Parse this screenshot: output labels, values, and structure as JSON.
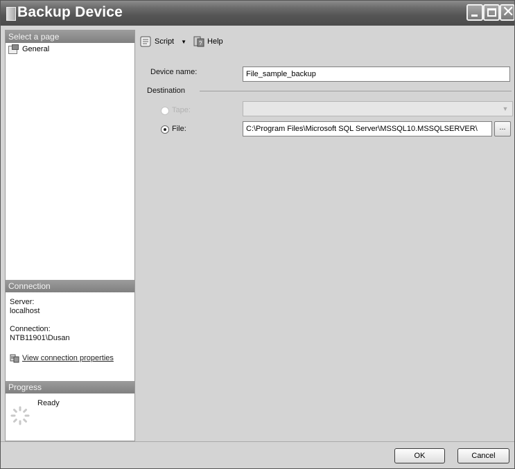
{
  "window": {
    "title": "Backup Device"
  },
  "left_pane": {
    "select_page_header": "Select a page",
    "pages": [
      {
        "label": "General",
        "icon": "page-icon"
      }
    ],
    "connection_header": "Connection",
    "server_label": "Server:",
    "server_value": "localhost",
    "connection_label": "Connection:",
    "connection_value": "NTB11901\\Dusan",
    "view_connection_link": "View connection properties",
    "progress_header": "Progress",
    "progress_status": "Ready"
  },
  "toolbar": {
    "script_label": "Script",
    "help_label": "Help"
  },
  "form": {
    "device_name_label": "Device name:",
    "device_name_value": "File_sample_backup",
    "destination_label": "Destination",
    "tape_label": "Tape:",
    "tape_value": "",
    "file_label": "File:",
    "file_value": "C:\\Program Files\\Microsoft SQL Server\\MSSQL10.MSSQLSERVER\\",
    "browse_label": "...",
    "selected_destination": "File"
  },
  "buttons": {
    "ok_label": "OK",
    "cancel_label": "Cancel"
  }
}
